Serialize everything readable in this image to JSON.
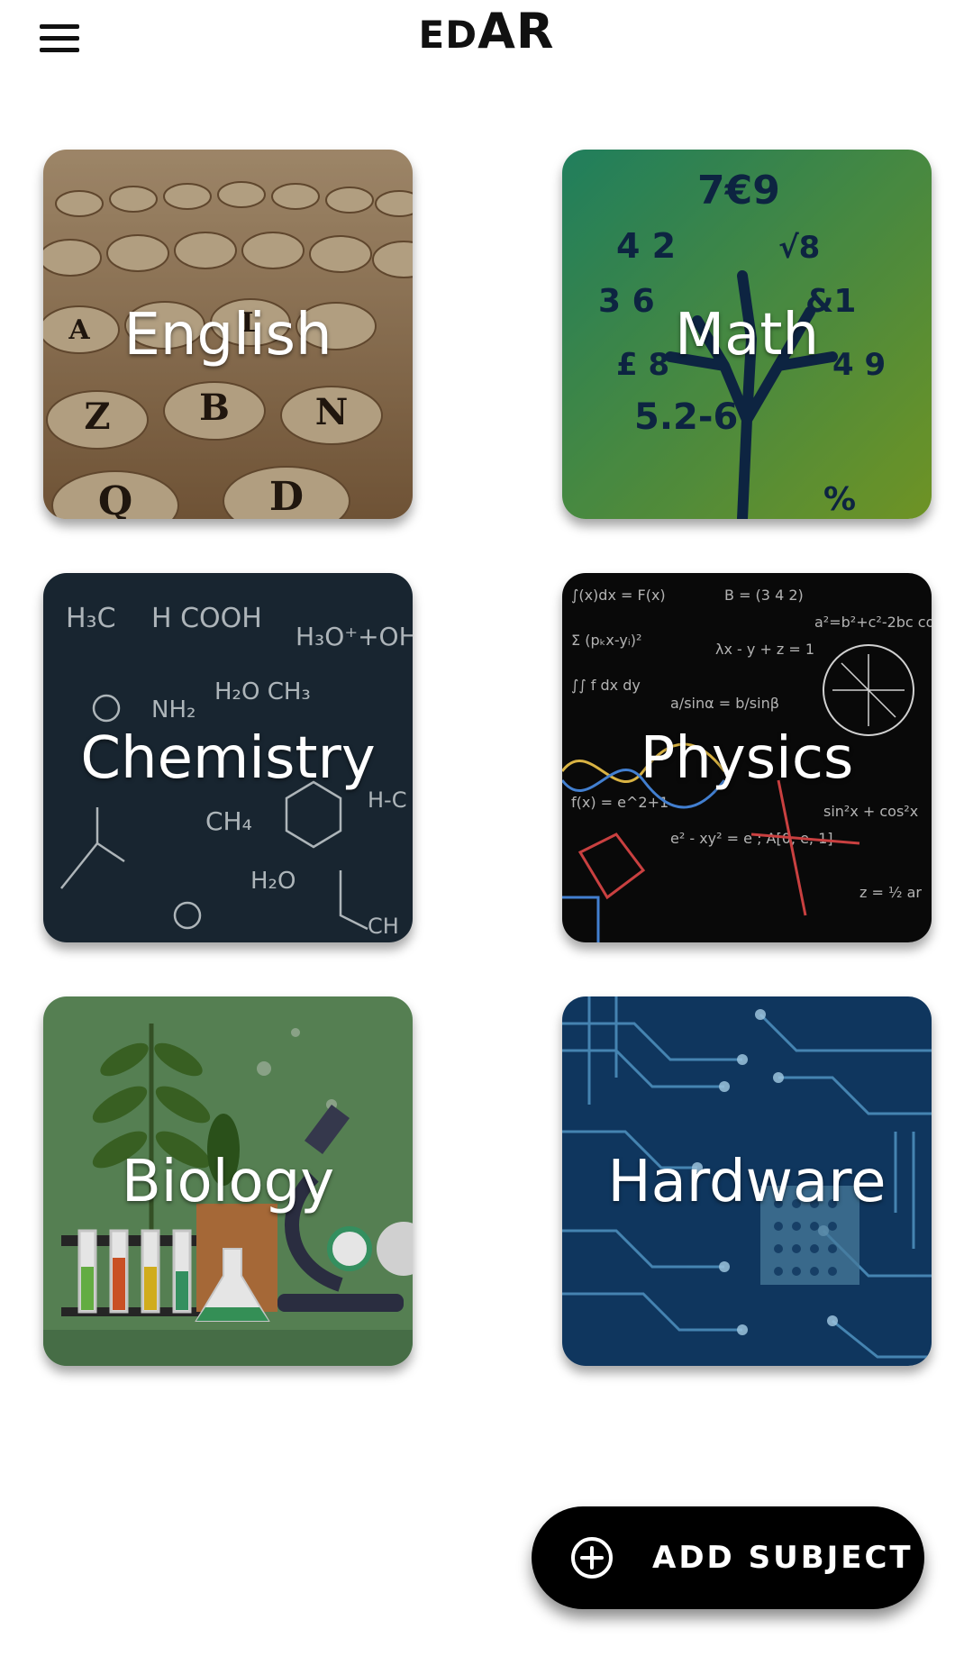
{
  "app": {
    "title_prefix": "ED",
    "title_suffix": "AR"
  },
  "subjects": [
    {
      "name": "English",
      "icon": "letter-dice-image",
      "color": "#b48a5a"
    },
    {
      "name": "Math",
      "icon": "number-tree-image",
      "color": "#2f8a5a"
    },
    {
      "name": "Chemistry",
      "icon": "chemistry-chalkboard-image",
      "color": "#1b2a36"
    },
    {
      "name": "Physics",
      "icon": "physics-formulas-image",
      "color": "#0d0d0d"
    },
    {
      "name": "Biology",
      "icon": "lab-plants-image",
      "color": "#5e8b5a"
    },
    {
      "name": "Hardware",
      "icon": "circuit-board-image",
      "color": "#123d6a"
    }
  ],
  "fab": {
    "label": "ADD SUBJECT",
    "icon": "add-circle-icon"
  },
  "colors": {
    "background": "#ffffff",
    "fab_background": "#000000",
    "text_on_card": "#ffffff"
  }
}
